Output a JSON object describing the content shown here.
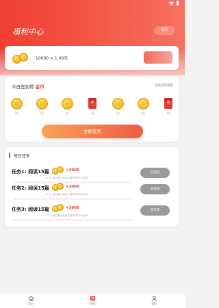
{
  "header": {
    "title": "福利中心",
    "rule_button": "规则"
  },
  "balance": {
    "text": "10000 ≈ 1.00元"
  },
  "checkin": {
    "title_prefix": "今日签到得 ",
    "title_highlight": "金币",
    "link": "连续签到规则",
    "button": "立即签到",
    "days": [
      {
        "type": "coin",
        "value": "10",
        "label": "1天"
      },
      {
        "type": "coin",
        "value": "10",
        "label": "2天"
      },
      {
        "type": "coin",
        "value": "10",
        "label": "3天"
      },
      {
        "type": "redbag",
        "value": "",
        "label": "4天"
      },
      {
        "type": "coin",
        "value": "10",
        "label": "5天"
      },
      {
        "type": "coin",
        "value": "10",
        "label": "6天"
      },
      {
        "type": "redbag",
        "value": "",
        "label": "7天"
      }
    ]
  },
  "tasks": {
    "heading": "每日任务",
    "items": [
      {
        "title": "任务1: 阅读15篇",
        "reward": "+3000",
        "desc": "0/15, 每日累计阅读15篇可得3000金币",
        "button": "已完成"
      },
      {
        "title": "任务2: 阅读15篇",
        "reward": "+3000",
        "desc": "0/15, 每日累计阅读15篇可得3000金币",
        "button": "去完成"
      },
      {
        "title": "任务3: 阅读15篇",
        "reward": "+3000",
        "desc": "0/15, 每日累计阅读15篇可得3000金币",
        "button": "去完成"
      }
    ]
  },
  "tabbar": {
    "items": [
      {
        "label": "首页",
        "icon": "home-icon",
        "active": false
      },
      {
        "label": "任务",
        "icon": "task-icon",
        "active": true
      },
      {
        "label": "我的",
        "icon": "profile-icon",
        "active": false
      }
    ]
  },
  "colors": {
    "accent": "#e8413c",
    "header_start": "#ef3f31",
    "header_end": "#f7715f",
    "button_grey": "#9a9a9a"
  }
}
